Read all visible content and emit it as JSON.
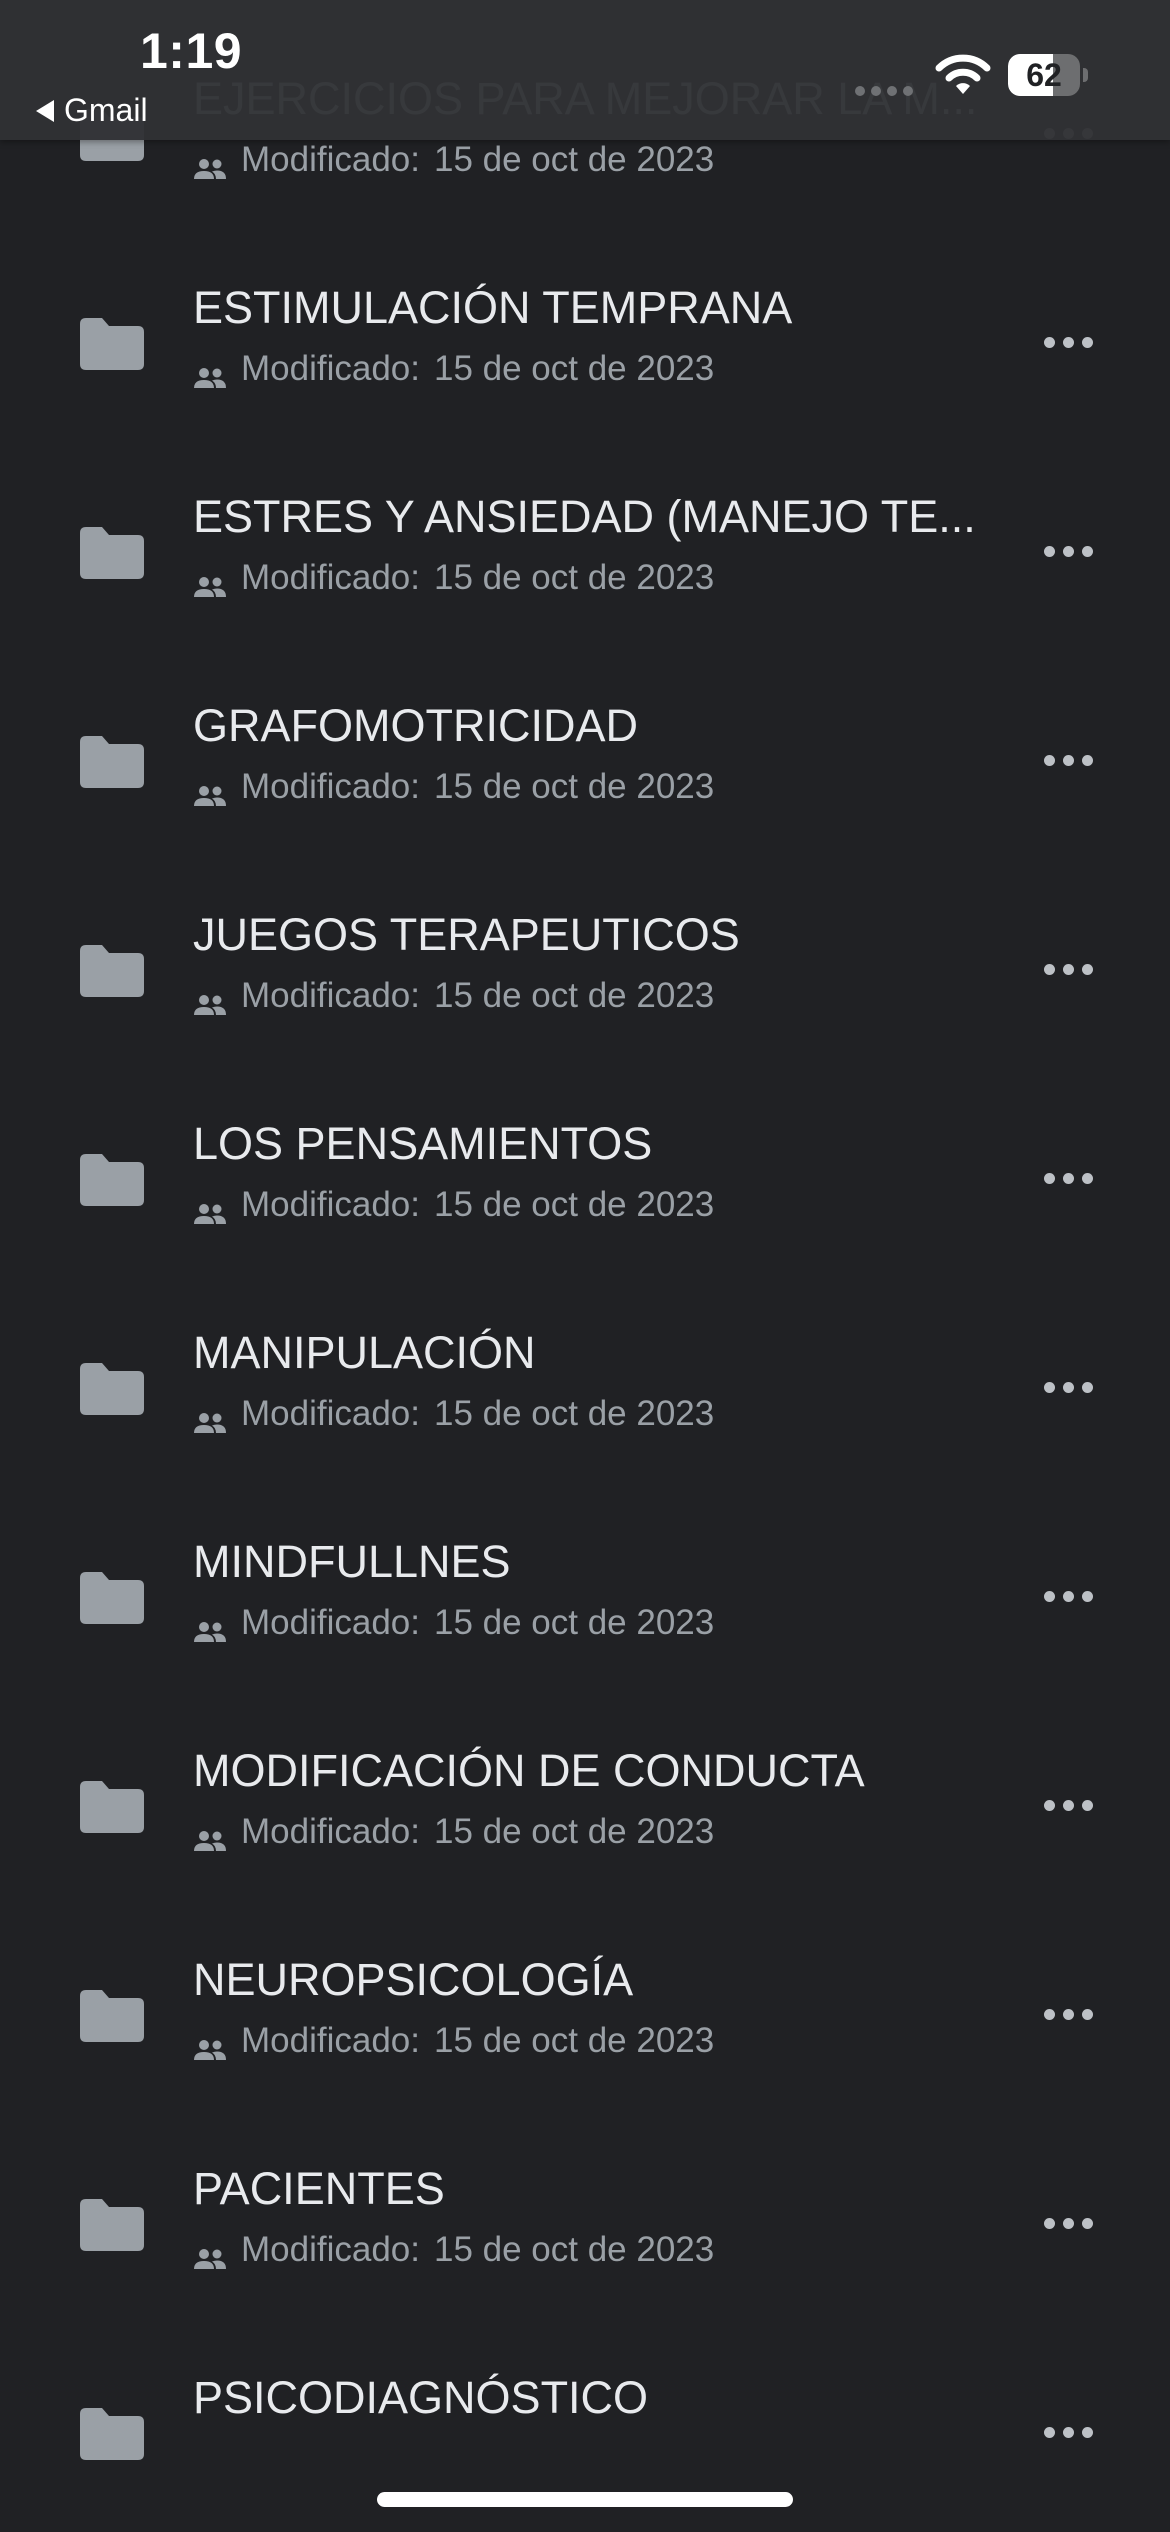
{
  "status_bar": {
    "time": "1:19",
    "back_label": "Gmail",
    "battery_level": "62",
    "battery_fraction": 0.62
  },
  "file_list": {
    "modified_prefix": "Modificado:",
    "items": [
      {
        "name": "",
        "modified": "15 de oct de 2023"
      },
      {
        "name": "EJERCICIOS PARA MEJORAR LA M...",
        "modified": "15 de oct de 2023"
      },
      {
        "name": "ESTIMULACIÓN TEMPRANA",
        "modified": "15 de oct de 2023"
      },
      {
        "name": "ESTRES Y ANSIEDAD (MANEJO TE...",
        "modified": "15 de oct de 2023"
      },
      {
        "name": "GRAFOMOTRICIDAD",
        "modified": "15 de oct de 2023"
      },
      {
        "name": "JUEGOS TERAPEUTICOS",
        "modified": "15 de oct de 2023"
      },
      {
        "name": "LOS PENSAMIENTOS",
        "modified": "15 de oct de 2023"
      },
      {
        "name": "MANIPULACIÓN",
        "modified": "15 de oct de 2023"
      },
      {
        "name": "MINDFULLNES",
        "modified": "15 de oct de 2023"
      },
      {
        "name": "MODIFICACIÓN DE CONDUCTA",
        "modified": "15 de oct de 2023"
      },
      {
        "name": "NEUROPSICOLOGÍA",
        "modified": "15 de oct de 2023"
      },
      {
        "name": "PACIENTES",
        "modified": "15 de oct de 2023"
      },
      {
        "name": "PSICODIAGNÓSTICO",
        "modified": ""
      }
    ]
  },
  "icons": {
    "folder": "folder-icon",
    "shared": "shared-icon",
    "more": "more-icon",
    "wifi": "wifi-icon",
    "back": "back-icon"
  },
  "colors": {
    "background": "#202124",
    "status_bar": "#303134",
    "text_primary": "#e8eaed",
    "text_secondary": "#9aa0a6",
    "icon": "#9aa0a6"
  }
}
